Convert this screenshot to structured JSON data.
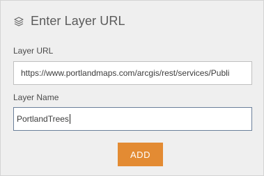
{
  "header": {
    "icon": "layers-icon",
    "title": "Enter Layer URL"
  },
  "form": {
    "url_label": "Layer URL",
    "url_value": "https://www.portlandmaps.com/arcgis/rest/services/Publi",
    "name_label": "Layer Name",
    "name_value": "PortlandTrees"
  },
  "actions": {
    "add_label": "ADD"
  },
  "colors": {
    "panel_bg": "#efefef",
    "button_bg": "#e38b33",
    "focus_border": "#6a7f9a"
  }
}
